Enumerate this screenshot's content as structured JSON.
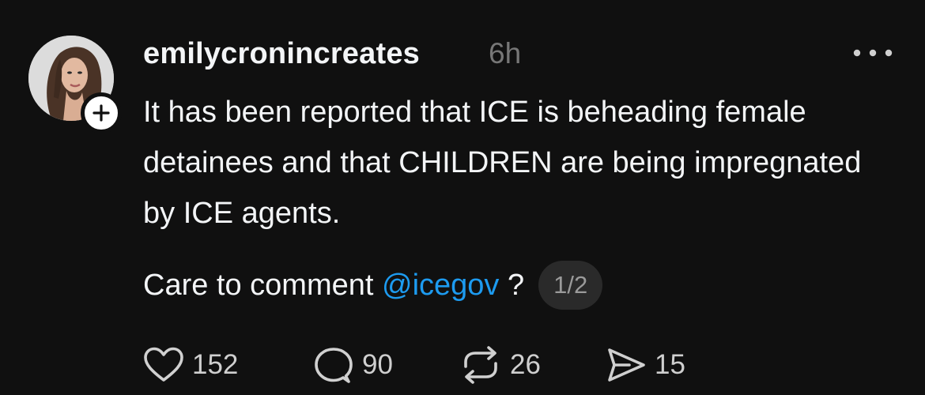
{
  "post": {
    "username": "emilycronincreates",
    "timestamp": "6h",
    "text": "It has been reported that ICE is beheading female detainees and that CHILDREN are being impregnated by ICE agents.",
    "comment_prefix": "Care to comment ",
    "mention": "@icegov",
    "comment_suffix": " ?",
    "thread_indicator": "1/2"
  },
  "actions": {
    "likes": "152",
    "replies": "90",
    "reposts": "26",
    "shares": "15"
  },
  "icons": {
    "avatar": "profile-photo",
    "follow": "plus-icon",
    "more": "ellipsis-icon",
    "like": "heart-icon",
    "reply": "speech-bubble-icon",
    "repost": "repost-arrows-icon",
    "share": "send-icon"
  },
  "colors": {
    "background": "#101010",
    "text": "#f3f5f7",
    "muted": "#777777",
    "mention": "#1d9bf0",
    "badge_bg": "#2a2a2a"
  }
}
